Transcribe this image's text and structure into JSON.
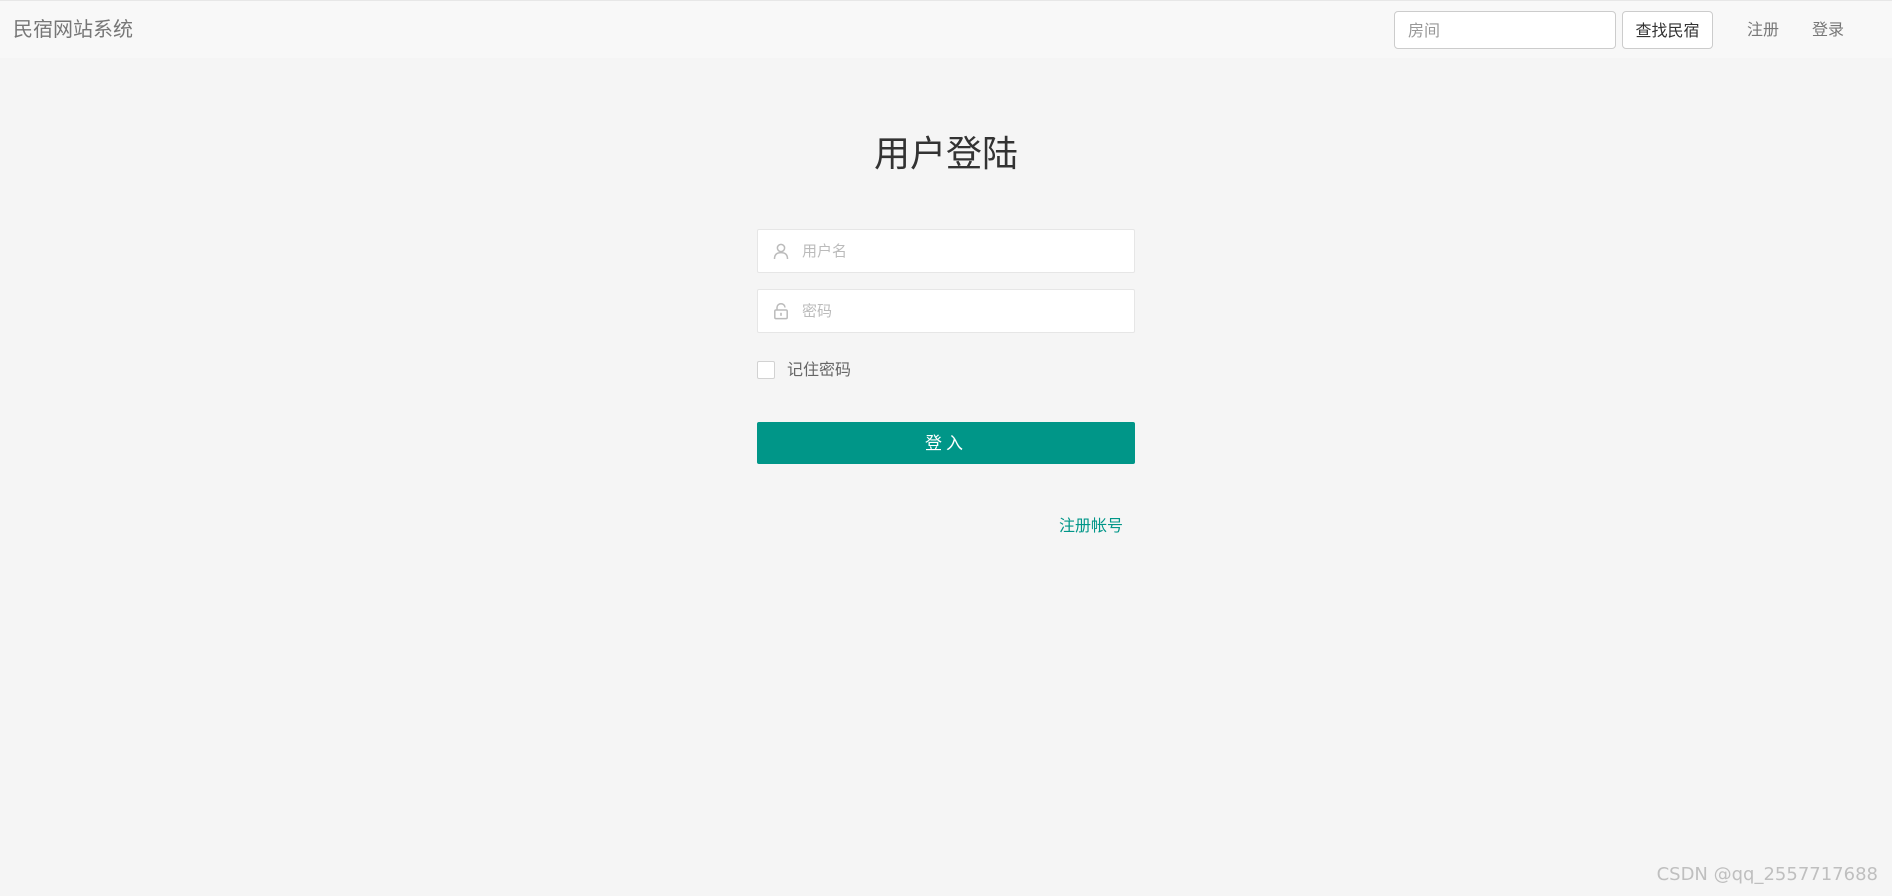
{
  "navbar": {
    "brand": "民宿网站系统",
    "search_placeholder": "房间",
    "search_button": "查找民宿",
    "register_link": "注册",
    "login_link": "登录"
  },
  "login": {
    "title": "用户登陆",
    "username_placeholder": "用户名",
    "password_placeholder": "密码",
    "remember_label": "记住密码",
    "submit_label": "登入",
    "register_link": "注册帐号"
  },
  "watermark": "CSDN @qq_2557717688",
  "colors": {
    "accent": "#009688",
    "page_bg": "#f5f5f5",
    "navbar_bg": "#f8f8f8"
  },
  "icons": {
    "username": "user-icon",
    "password": "lock-icon"
  }
}
